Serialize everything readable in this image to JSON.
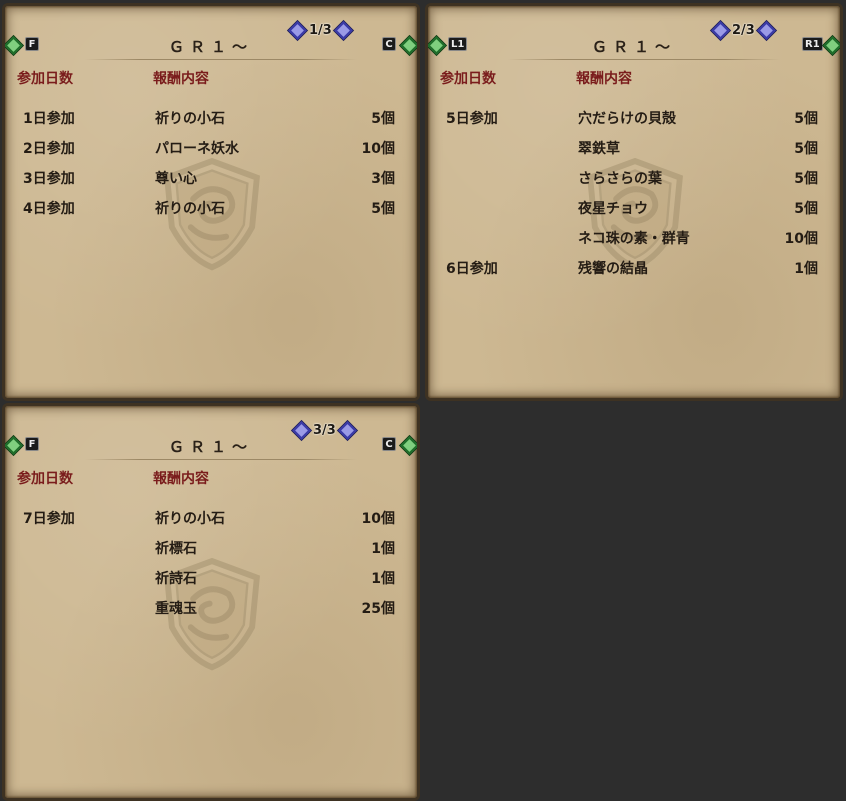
{
  "header_days": "参加日数",
  "header_reward": "報酬内容",
  "panels": [
    {
      "title": "ＧＲ１～",
      "page": "1/3",
      "left_button": "F",
      "right_button": "C",
      "rows": [
        {
          "day": "1日参加",
          "item": "祈りの小石",
          "qty": "5個"
        },
        {
          "day": "2日参加",
          "item": "パローネ妖水",
          "qty": "10個"
        },
        {
          "day": "3日参加",
          "item": "尊い心",
          "qty": "3個"
        },
        {
          "day": "4日参加",
          "item": "祈りの小石",
          "qty": "5個"
        }
      ]
    },
    {
      "title": "ＧＲ１～",
      "page": "2/3",
      "left_button": "L1",
      "right_button": "R1",
      "rows": [
        {
          "day": "5日参加",
          "item": "穴だらけの貝殻",
          "qty": "5個"
        },
        {
          "day": "",
          "item": "翠鉄草",
          "qty": "5個"
        },
        {
          "day": "",
          "item": "さらさらの葉",
          "qty": "5個"
        },
        {
          "day": "",
          "item": "夜星チョウ",
          "qty": "5個"
        },
        {
          "day": "",
          "item": "ネコ珠の素・群青",
          "qty": "10個"
        },
        {
          "day": "6日参加",
          "item": "残響の結晶",
          "qty": "1個"
        }
      ]
    },
    {
      "title": "ＧＲ１～",
      "page": "3/3",
      "left_button": "F",
      "right_button": "C",
      "rows": [
        {
          "day": "7日参加",
          "item": "祈りの小石",
          "qty": "10個"
        },
        {
          "day": "",
          "item": "祈標石",
          "qty": "1個"
        },
        {
          "day": "",
          "item": "祈詩石",
          "qty": "1個"
        },
        {
          "day": "",
          "item": "重魂玉",
          "qty": "25個"
        }
      ]
    }
  ]
}
